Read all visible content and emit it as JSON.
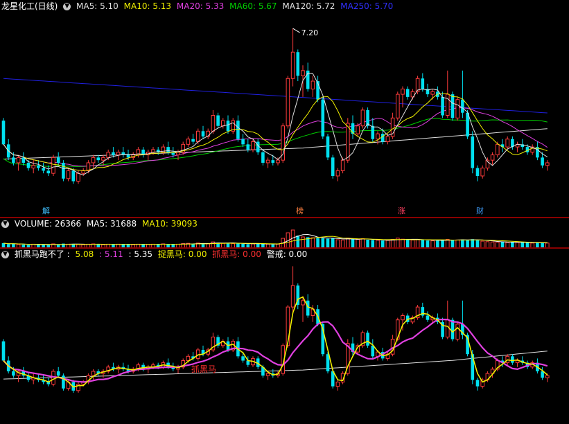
{
  "colors": {
    "up": "#ff3c3c",
    "down": "#00e0f0",
    "ma5": "#e0e0e0",
    "ma10": "#f0f000",
    "ma20": "#e040e0",
    "ma60": "#00d000",
    "ma120": "#e0e0e0",
    "ma250": "#2020e0"
  },
  "price_header": {
    "title": "龙星化工(日线)",
    "ma5": "MA5: 5.10",
    "ma10": "MA10: 5.13",
    "ma20": "MA20: 5.33",
    "ma60": "MA60: 5.67",
    "ma120": "MA120: 5.72",
    "ma250": "MA250: 5.70",
    "peak_label": "7.20"
  },
  "events": {
    "e1": "解",
    "e2": "榜",
    "e3": "涨",
    "e4": "财"
  },
  "volume_header": {
    "title": "VOLUME: 26366",
    "ma5": "MA5: 31688",
    "ma10": "MA10: 39093"
  },
  "indicator_header": {
    "title": "抓黑马跑不了 :",
    "v1": "5.08",
    "v2": ": 5.11",
    "v3": ": 5.35",
    "l1": "捉黑马: 0.00",
    "l2": "抓黑马: 0.00",
    "l3": "警戒: 0.00",
    "annot": "抓黑马"
  },
  "chart_data": {
    "type": "candlestick",
    "symbol": "龙星化工",
    "period": "日线",
    "peak": 7.2,
    "ylim": [
      3.9,
      7.45
    ],
    "candles": [
      [
        5.45,
        5.5,
        5.0,
        5.0
      ],
      [
        5.0,
        5.1,
        4.7,
        4.75
      ],
      [
        4.75,
        4.85,
        4.6,
        4.65
      ],
      [
        4.65,
        4.8,
        4.5,
        4.75
      ],
      [
        4.75,
        4.85,
        4.6,
        4.65
      ],
      [
        4.65,
        4.7,
        4.5,
        4.55
      ],
      [
        4.55,
        4.7,
        4.45,
        4.6
      ],
      [
        4.6,
        4.7,
        4.5,
        4.55
      ],
      [
        4.55,
        4.65,
        4.45,
        4.5
      ],
      [
        4.5,
        4.6,
        4.4,
        4.45
      ],
      [
        4.45,
        4.8,
        4.4,
        4.75
      ],
      [
        4.75,
        4.85,
        4.6,
        4.65
      ],
      [
        4.65,
        4.7,
        4.3,
        4.35
      ],
      [
        4.35,
        4.55,
        4.3,
        4.5
      ],
      [
        4.5,
        4.55,
        4.25,
        4.3
      ],
      [
        4.3,
        4.5,
        4.25,
        4.45
      ],
      [
        4.45,
        4.55,
        4.4,
        4.5
      ],
      [
        4.5,
        4.7,
        4.45,
        4.65
      ],
      [
        4.65,
        4.8,
        4.55,
        4.75
      ],
      [
        4.75,
        4.8,
        4.65,
        4.7
      ],
      [
        4.7,
        4.8,
        4.6,
        4.75
      ],
      [
        4.75,
        4.9,
        4.7,
        4.85
      ],
      [
        4.85,
        4.95,
        4.75,
        4.8
      ],
      [
        4.8,
        4.9,
        4.7,
        4.85
      ],
      [
        4.85,
        4.95,
        4.75,
        4.8
      ],
      [
        4.8,
        4.9,
        4.7,
        4.75
      ],
      [
        4.75,
        4.85,
        4.7,
        4.8
      ],
      [
        4.8,
        4.95,
        4.75,
        4.9
      ],
      [
        4.9,
        4.95,
        4.75,
        4.8
      ],
      [
        4.8,
        4.9,
        4.7,
        4.85
      ],
      [
        4.85,
        4.95,
        4.8,
        4.9
      ],
      [
        4.9,
        4.95,
        4.8,
        4.85
      ],
      [
        4.85,
        5.0,
        4.8,
        4.95
      ],
      [
        4.95,
        5.05,
        4.8,
        4.85
      ],
      [
        4.85,
        4.95,
        4.75,
        4.8
      ],
      [
        4.8,
        4.9,
        4.7,
        4.85
      ],
      [
        4.85,
        5.05,
        4.8,
        5.0
      ],
      [
        5.0,
        5.15,
        4.95,
        5.1
      ],
      [
        5.1,
        5.2,
        5.0,
        5.05
      ],
      [
        5.05,
        5.3,
        5.0,
        5.25
      ],
      [
        5.25,
        5.35,
        5.1,
        5.15
      ],
      [
        5.15,
        5.3,
        5.1,
        5.25
      ],
      [
        5.25,
        5.65,
        5.2,
        5.55
      ],
      [
        5.55,
        5.6,
        5.3,
        5.35
      ],
      [
        5.35,
        5.5,
        5.3,
        5.45
      ],
      [
        5.45,
        5.55,
        5.2,
        5.25
      ],
      [
        5.25,
        5.5,
        5.2,
        5.45
      ],
      [
        5.45,
        5.55,
        5.05,
        5.1
      ],
      [
        5.1,
        5.2,
        4.95,
        5.0
      ],
      [
        5.0,
        5.1,
        4.85,
        4.9
      ],
      [
        4.9,
        5.1,
        4.85,
        5.05
      ],
      [
        5.05,
        5.1,
        4.8,
        4.85
      ],
      [
        4.85,
        4.9,
        4.6,
        4.65
      ],
      [
        4.65,
        4.75,
        4.55,
        4.7
      ],
      [
        4.7,
        4.8,
        4.6,
        4.65
      ],
      [
        4.65,
        4.75,
        4.6,
        4.7
      ],
      [
        4.7,
        5.4,
        4.65,
        5.35
      ],
      [
        5.35,
        6.3,
        5.3,
        6.25
      ],
      [
        6.25,
        7.2,
        6.1,
        6.75
      ],
      [
        6.75,
        6.8,
        6.2,
        6.3
      ],
      [
        6.3,
        6.5,
        5.9,
        6.4
      ],
      [
        6.4,
        6.55,
        6.0,
        6.05
      ],
      [
        6.05,
        6.3,
        5.9,
        6.2
      ],
      [
        6.2,
        6.3,
        5.8,
        5.85
      ],
      [
        5.85,
        5.9,
        5.1,
        5.15
      ],
      [
        5.15,
        5.2,
        4.7,
        4.75
      ],
      [
        4.75,
        4.8,
        4.35,
        4.4
      ],
      [
        4.4,
        4.55,
        4.3,
        4.5
      ],
      [
        4.5,
        4.75,
        4.45,
        4.7
      ],
      [
        4.7,
        5.5,
        4.65,
        5.4
      ],
      [
        5.4,
        5.55,
        5.1,
        5.2
      ],
      [
        5.2,
        5.4,
        5.15,
        5.35
      ],
      [
        5.35,
        5.7,
        5.3,
        5.65
      ],
      [
        5.65,
        5.7,
        5.3,
        5.35
      ],
      [
        5.35,
        5.5,
        5.05,
        5.1
      ],
      [
        5.1,
        5.25,
        5.0,
        5.2
      ],
      [
        5.2,
        5.3,
        5.0,
        5.05
      ],
      [
        5.05,
        5.2,
        5.0,
        5.15
      ],
      [
        5.15,
        5.6,
        5.1,
        5.5
      ],
      [
        5.5,
        6.0,
        5.45,
        5.95
      ],
      [
        5.95,
        6.1,
        5.7,
        6.05
      ],
      [
        6.05,
        6.1,
        5.85,
        5.9
      ],
      [
        5.9,
        6.05,
        5.85,
        6.0
      ],
      [
        6.0,
        6.3,
        5.95,
        6.25
      ],
      [
        6.25,
        6.35,
        6.0,
        6.05
      ],
      [
        6.05,
        6.15,
        5.9,
        5.95
      ],
      [
        5.95,
        6.05,
        5.85,
        6.0
      ],
      [
        6.0,
        6.1,
        5.85,
        5.9
      ],
      [
        5.9,
        6.0,
        5.5,
        5.55
      ],
      [
        5.55,
        6.4,
        5.5,
        5.95
      ],
      [
        5.95,
        6.0,
        5.45,
        5.5
      ],
      [
        5.5,
        5.9,
        5.45,
        5.85
      ],
      [
        5.85,
        6.4,
        5.5,
        5.6
      ],
      [
        5.6,
        5.65,
        5.1,
        5.15
      ],
      [
        5.15,
        5.25,
        4.45,
        4.55
      ],
      [
        4.55,
        4.6,
        4.3,
        4.4
      ],
      [
        4.4,
        4.6,
        4.35,
        4.55
      ],
      [
        4.55,
        4.75,
        4.5,
        4.7
      ],
      [
        4.7,
        4.85,
        4.6,
        4.8
      ],
      [
        4.8,
        5.05,
        4.75,
        5.0
      ],
      [
        5.0,
        5.1,
        4.85,
        4.95
      ],
      [
        4.95,
        5.15,
        4.9,
        5.1
      ],
      [
        5.1,
        5.15,
        4.9,
        4.95
      ],
      [
        4.95,
        5.05,
        4.85,
        5.0
      ],
      [
        5.0,
        5.1,
        4.9,
        4.95
      ],
      [
        4.95,
        5.0,
        4.8,
        4.85
      ],
      [
        4.85,
        5.0,
        4.8,
        4.95
      ],
      [
        4.95,
        5.05,
        4.7,
        4.75
      ],
      [
        4.75,
        4.85,
        4.55,
        4.6
      ],
      [
        4.6,
        4.7,
        4.5,
        4.65
      ]
    ],
    "volumes": [
      35,
      28,
      30,
      26,
      24,
      22,
      28,
      25,
      24,
      22,
      30,
      26,
      32,
      28,
      30,
      26,
      24,
      28,
      30,
      26,
      24,
      28,
      26,
      28,
      30,
      26,
      24,
      28,
      30,
      26,
      28,
      26,
      30,
      28,
      26,
      28,
      32,
      34,
      30,
      36,
      32,
      30,
      44,
      38,
      34,
      36,
      32,
      34,
      30,
      28,
      30,
      32,
      30,
      28,
      26,
      28,
      70,
      110,
      130,
      90,
      80,
      78,
      74,
      72,
      70,
      68,
      72,
      60,
      58,
      72,
      64,
      62,
      68,
      60,
      58,
      56,
      54,
      55,
      62,
      72,
      64,
      60,
      58,
      62,
      58,
      54,
      52,
      54,
      60,
      62,
      56,
      58,
      62,
      58,
      64,
      56,
      50,
      46,
      44,
      42,
      44,
      40,
      42,
      40,
      40,
      38,
      36,
      38,
      36,
      36
    ],
    "series": [
      {
        "name": "MA5",
        "window": 5
      },
      {
        "name": "MA10",
        "window": 10
      },
      {
        "name": "MA20",
        "window": 20
      },
      {
        "name": "MA60",
        "window": 60
      },
      {
        "name": "MA120",
        "window": 120
      },
      {
        "name": "MA250",
        "window": 250
      }
    ]
  }
}
